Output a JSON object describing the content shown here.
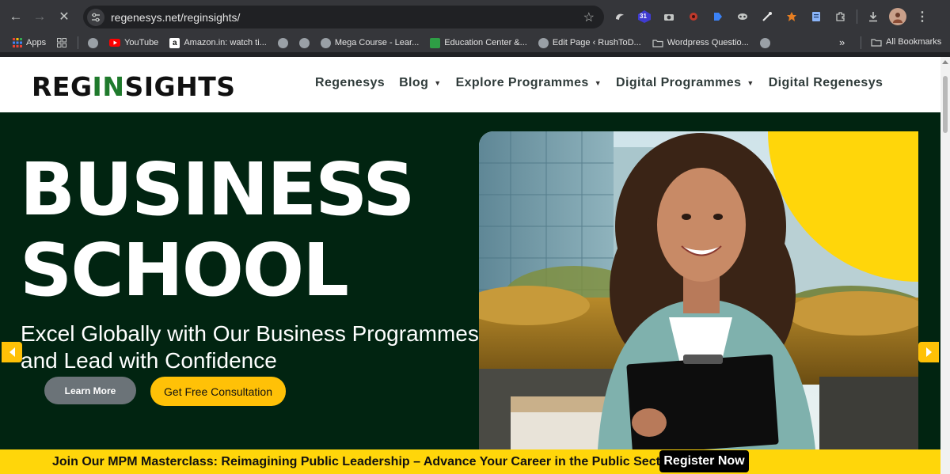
{
  "browser": {
    "url": "regenesys.net/reginsights/",
    "calendar_badge": "31",
    "bookmarks": [
      {
        "label": "Apps",
        "icon": "apps-grid-icon"
      },
      {
        "label": "",
        "icon": "tab-groups-icon"
      },
      {
        "label": "",
        "icon": "globe-icon"
      },
      {
        "label": "YouTube",
        "icon": "youtube-icon"
      },
      {
        "label": "Amazon.in: watch ti...",
        "icon": "amazon-icon"
      },
      {
        "label": "",
        "icon": "globe-icon"
      },
      {
        "label": "",
        "icon": "globe-icon"
      },
      {
        "label": "Mega Course - Lear...",
        "icon": "globe-icon"
      },
      {
        "label": "Education Center &...",
        "icon": "education-icon"
      },
      {
        "label": "Edit Page ‹ RushToD...",
        "icon": "globe-icon"
      },
      {
        "label": "Wordpress Questio...",
        "icon": "folder-icon"
      },
      {
        "label": "",
        "icon": "globe-icon"
      }
    ],
    "all_bookmarks": "All Bookmarks",
    "overflow": "»"
  },
  "site": {
    "logo": {
      "part1": "REG",
      "part2": "IN",
      "part3": "SIGHTS"
    },
    "nav": [
      {
        "label": "Regenesys",
        "dropdown": false
      },
      {
        "label": "Blog",
        "dropdown": true
      },
      {
        "label": "Explore Programmes",
        "dropdown": true
      },
      {
        "label": "Digital Programmes",
        "dropdown": true
      },
      {
        "label": "Digital Regenesys",
        "dropdown": false
      }
    ]
  },
  "hero": {
    "title_line1": "BUSINESS",
    "title_line2": "SCHOOL",
    "subtitle": "Excel Globally with Our Business Programmes and Lead with Confidence",
    "learn_more": "Learn More",
    "consultation": "Get Free Consultation",
    "background_color": "#012411",
    "accent_color": "#ffc107"
  },
  "banner": {
    "text": "Join Our MPM Masterclass: Reimagining Public Leadership – Advance Your Career in the Public Sector",
    "button": "Register Now",
    "color": "#ffd60a"
  }
}
